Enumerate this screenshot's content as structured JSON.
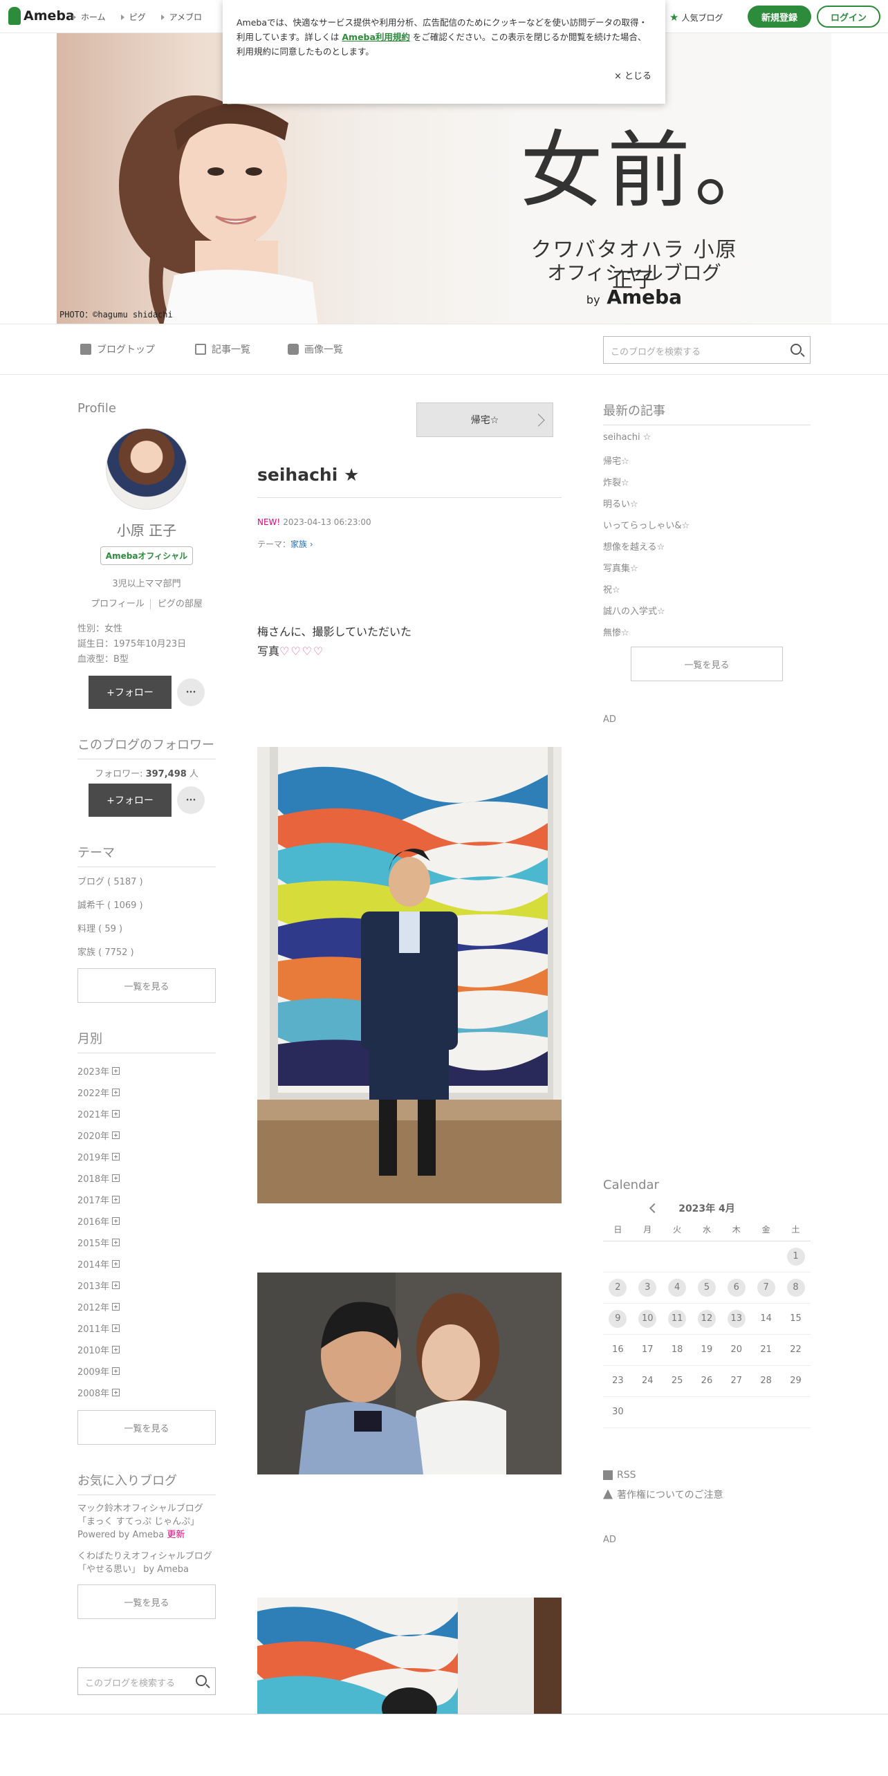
{
  "topbar": {
    "logo": "Ameba",
    "nav": [
      "ホーム",
      "ピグ",
      "アメブロ"
    ],
    "popular": "人気ブログ",
    "register": "新規登録",
    "login": "ログイン"
  },
  "cookie": {
    "text_pre": "Amebaでは、快適なサービス提供や利用分析、広告配信のためにクッキーなどを使い訪問データの取得・利用しています。詳しくは",
    "link": "Ameba利用規約",
    "text_post": "をご確認ください。この表示を閉じるか閲覧を続けた場合、利用規約に同意したものとします。",
    "close": "× とじる"
  },
  "header": {
    "title": "女前。",
    "sub1": "クワバタオハラ 小原正子",
    "sub2": "オフィシャルブログ",
    "by": "by",
    "ameba": "Ameba",
    "credit": "PHOTO：©hagumu shidachi"
  },
  "blognav": {
    "top": "ブログトップ",
    "list": "記事一覧",
    "images": "画像一覧",
    "search_placeholder": "このブログを検索する"
  },
  "profile": {
    "heading": "Profile",
    "name": "小原 正子",
    "badge": "Amebaオフィシャル",
    "tag": "3児以上ママ部門",
    "link1": "プロフィール",
    "link2": "ピグの部屋",
    "gender": "性別：女性",
    "birthday": "誕生日：1975年10月23日",
    "blood": "血液型：B型",
    "follow": "+フォロー",
    "more": "···"
  },
  "followers": {
    "heading": "このブログのフォロワー",
    "label": "フォロワー: ",
    "count": "397,498",
    "unit": " 人",
    "follow": "+フォロー",
    "more": "···"
  },
  "theme": {
    "heading": "テーマ",
    "items": [
      "ブログ ( 5187 )",
      "誠希千 ( 1069 )",
      "料理 ( 59 )",
      "家族 ( 7752 )"
    ],
    "all": "一覧を見る"
  },
  "monthly": {
    "heading": "月別",
    "years": [
      "2023年",
      "2022年",
      "2021年",
      "2020年",
      "2019年",
      "2018年",
      "2017年",
      "2016年",
      "2015年",
      "2014年",
      "2013年",
      "2012年",
      "2011年",
      "2010年",
      "2009年",
      "2008年"
    ],
    "all": "一覧を見る"
  },
  "favorites": {
    "heading": "お気に入りブログ",
    "item1_a": "マック鈴木オフィシャルブログ「まっく すてっぷ じゃんぷ」Powered by Ameba",
    "item1_upd": "更新",
    "item2": "くわばたりえオフィシャルブログ「やせる思い」 by Ameba",
    "all": "一覧を見る",
    "search_placeholder": "このブログを検索する"
  },
  "entry": {
    "prev": "帰宅☆",
    "title": "seihachi ★",
    "new": "NEW!",
    "date": "2023-04-13 06:23:00",
    "theme_label": "テーマ：",
    "theme": "家族",
    "body1": "梅さんに、撮影していただいた",
    "body2": "写真",
    "hearts": "♡♡♡♡"
  },
  "recent": {
    "heading": "最新の記事",
    "items": [
      "seihachi ☆",
      "帰宅☆",
      "炸裂☆",
      "明るい☆",
      "いってらっしゃい&☆",
      "想像を越える☆",
      "写真集☆",
      "祝☆",
      "誠八の入学式☆",
      "無惨☆"
    ],
    "all": "一覧を見る"
  },
  "ad": "AD",
  "calendar": {
    "heading": "Calendar",
    "month": "2023年 4月",
    "weekdays": [
      "日",
      "月",
      "火",
      "水",
      "木",
      "金",
      "土"
    ],
    "weeks": [
      [
        "",
        "",
        "",
        "",
        "",
        "",
        "1"
      ],
      [
        "2",
        "3",
        "4",
        "5",
        "6",
        "7",
        "8"
      ],
      [
        "9",
        "10",
        "11",
        "12",
        "13",
        "14",
        "15"
      ],
      [
        "16",
        "17",
        "18",
        "19",
        "20",
        "21",
        "22"
      ],
      [
        "23",
        "24",
        "25",
        "26",
        "27",
        "28",
        "29"
      ],
      [
        "30",
        "",
        "",
        "",
        "",
        "",
        ""
      ]
    ],
    "posted": [
      "1",
      "2",
      "3",
      "4",
      "5",
      "6",
      "7",
      "8",
      "9",
      "10",
      "11",
      "12",
      "13"
    ]
  },
  "links": {
    "rss": "RSS",
    "copyright": "著作権についてのご注意"
  },
  "colors": {
    "accent": "#2d8c3c",
    "new": "#e4007f"
  }
}
